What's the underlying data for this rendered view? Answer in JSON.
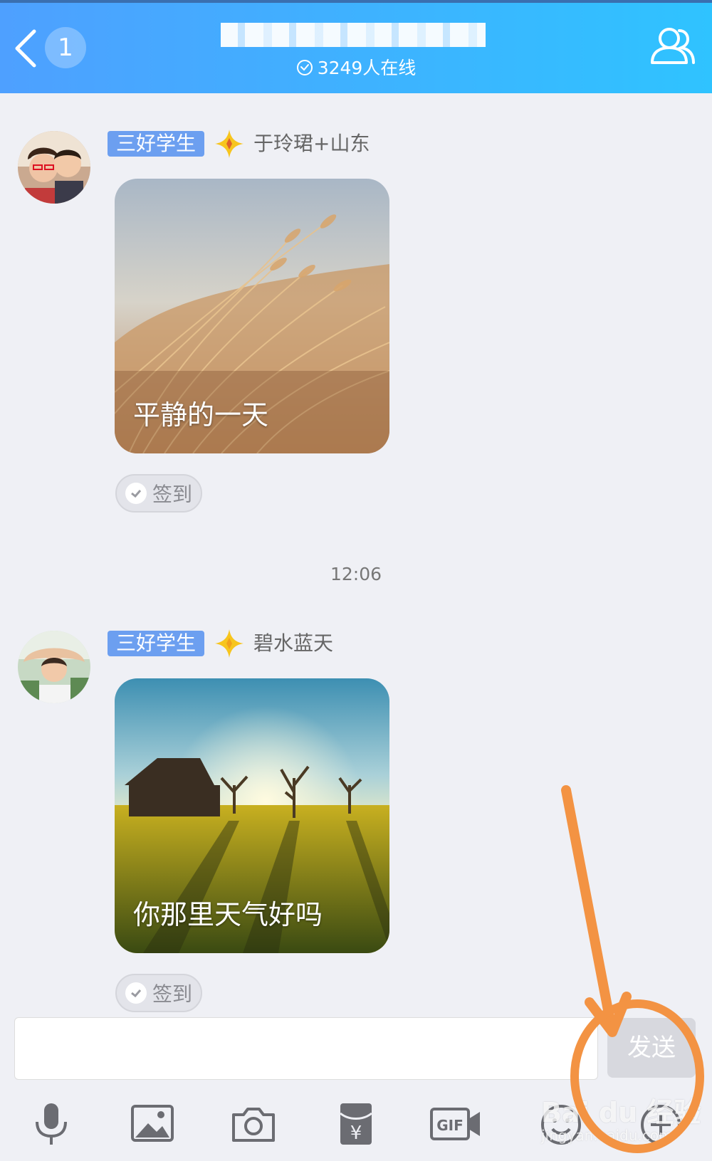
{
  "header": {
    "back_badge_count": "1",
    "online_text": "3249人在线"
  },
  "messages": [
    {
      "tag": "三好学生",
      "name": "于玲珺+山东",
      "card_text": "平静的一天",
      "checkin_label": "签到"
    },
    {
      "tag": "三好学生",
      "name": "碧水蓝天",
      "card_text": "你那里天气好吗",
      "checkin_label": "签到"
    }
  ],
  "timestamp": "12:06",
  "input": {
    "value": "",
    "send_label": "发送"
  },
  "toolbar": {
    "items": [
      "microphone-icon",
      "image-icon",
      "camera-icon",
      "red-packet-icon",
      "gif-icon",
      "emoji-icon",
      "plus-icon"
    ]
  },
  "watermark": {
    "brand": "Bai du 经验",
    "url": "jingyan.baidu.com"
  },
  "colors": {
    "header_start": "#4ea0ff",
    "header_end": "#2fc3ff",
    "tag_bg": "#6c9ff0",
    "annotation": "#f39343",
    "background": "#eff0f5"
  }
}
